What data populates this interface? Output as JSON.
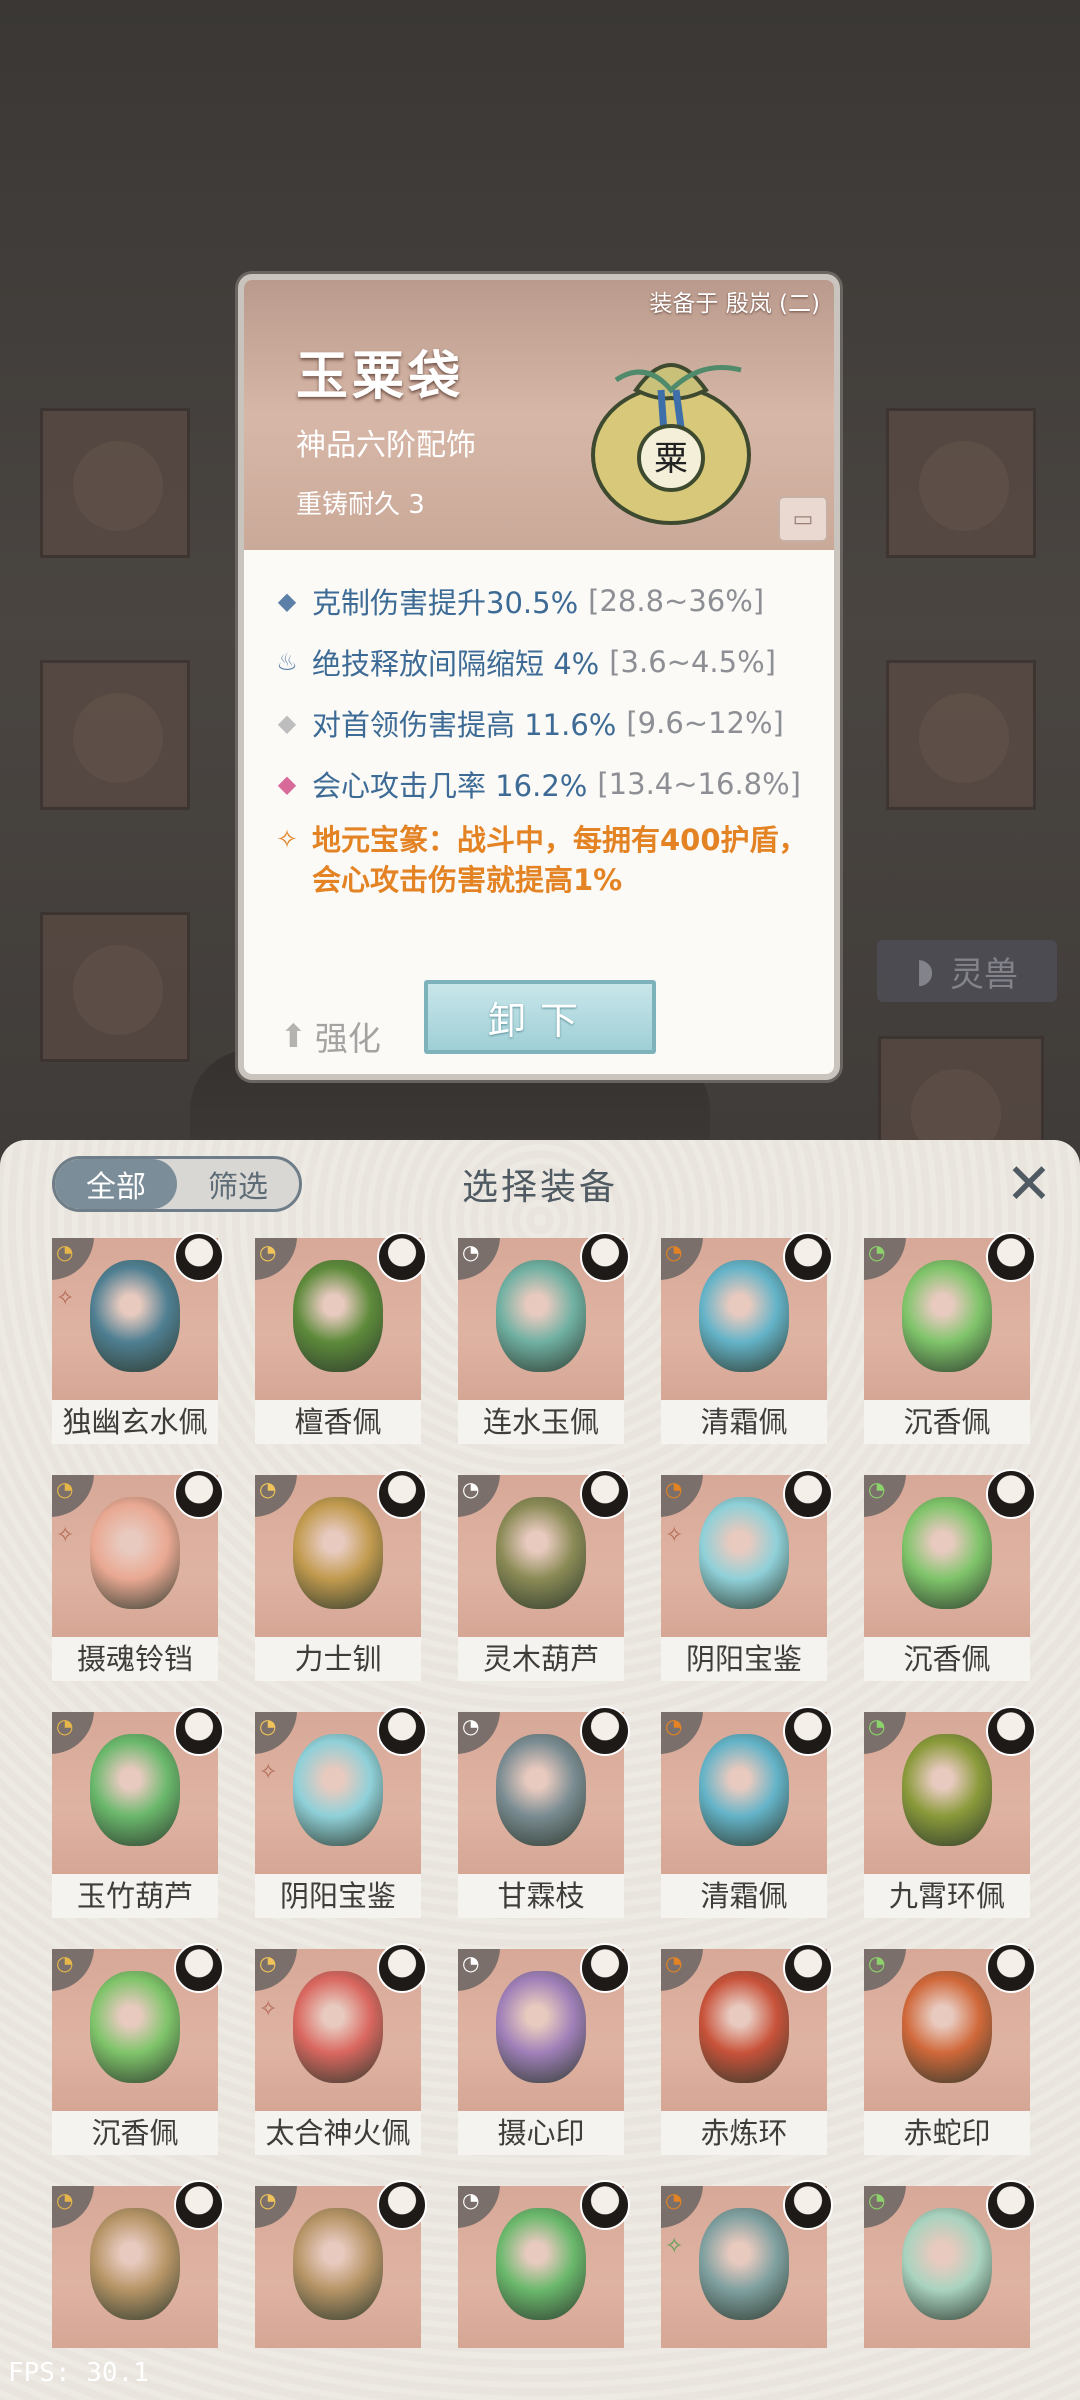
{
  "detail": {
    "equipped_text": "装备于 殷岚 (二)",
    "name": "玉粟袋",
    "grade": "神品六阶配饰",
    "durability": "重铸耐久 3",
    "stats": [
      {
        "icon": "diamond-icon",
        "color": "#5b7fa7",
        "text": "克制伤害提升30.5%",
        "range": "[28.8~36%]"
      },
      {
        "icon": "flame-icon",
        "color": "#5b7fa7",
        "text": "绝技释放间隔缩短 4%",
        "range": "[3.6~4.5%]"
      },
      {
        "icon": "diamond-icon",
        "color": "#bdbdbd",
        "text": "对首领伤害提高 11.6%",
        "range": "[9.6~12%]"
      },
      {
        "icon": "diamond-icon",
        "color": "#d86a9a",
        "text": "会心攻击几率 16.2%",
        "range": "[13.4~16.8%]"
      }
    ],
    "special": "地元宝篆：战斗中，每拥有400护盾，会心攻击伤害就提高1%",
    "enhance_label": "强化",
    "unequip_label": "卸下"
  },
  "background": {
    "pet_tab_label": "灵兽"
  },
  "sheet": {
    "tab_all": "全部",
    "tab_filter": "筛选",
    "title": "选择装备",
    "close_glyph": "✕",
    "items": [
      {
        "name": "独幽玄水佩",
        "color": "#4f7f92",
        "set": true
      },
      {
        "name": "檀香佩",
        "color": "#5d8a3a",
        "set": false
      },
      {
        "name": "连水玉佩",
        "color": "#6fb0a2",
        "set": false
      },
      {
        "name": "清霜佩",
        "color": "#64b3c8",
        "set": false
      },
      {
        "name": "沉香佩",
        "color": "#7fc46a",
        "set": false
      },
      {
        "name": "摄魂铃铛",
        "color": "#e9a892",
        "set": true
      },
      {
        "name": "力士钏",
        "color": "#c19a4e",
        "set": false
      },
      {
        "name": "灵木葫芦",
        "color": "#8a8a55",
        "set": false
      },
      {
        "name": "阴阳宝鉴",
        "color": "#8fd0d8",
        "set": true
      },
      {
        "name": "沉香佩",
        "color": "#7fc46a",
        "set": false
      },
      {
        "name": "玉竹葫芦",
        "color": "#6ab86c",
        "set": false
      },
      {
        "name": "阴阳宝鉴",
        "color": "#8fd0d8",
        "set": true
      },
      {
        "name": "甘霖枝",
        "color": "#7a8c92",
        "set": false
      },
      {
        "name": "清霜佩",
        "color": "#64b3c8",
        "set": false
      },
      {
        "name": "九霄环佩",
        "color": "#8a9a3a",
        "set": false
      },
      {
        "name": "沉香佩",
        "color": "#7fc46a",
        "set": false
      },
      {
        "name": "太合神火佩",
        "color": "#d9675f",
        "set": true
      },
      {
        "name": "摄心印",
        "color": "#9f7fb8",
        "set": false
      },
      {
        "name": "赤炼环",
        "color": "#c8523a",
        "set": false
      },
      {
        "name": "赤蛇印",
        "color": "#d0683a",
        "set": false
      },
      {
        "name": "",
        "color": "#b69466",
        "set": false
      },
      {
        "name": "",
        "color": "#b69466",
        "set": false
      },
      {
        "name": "",
        "color": "#6ab86c",
        "set": false
      },
      {
        "name": "",
        "color": "#7fa0a0",
        "set": true
      },
      {
        "name": "",
        "color": "#a9d3bf",
        "set": false
      }
    ]
  },
  "fps": "FPS: 30.1"
}
